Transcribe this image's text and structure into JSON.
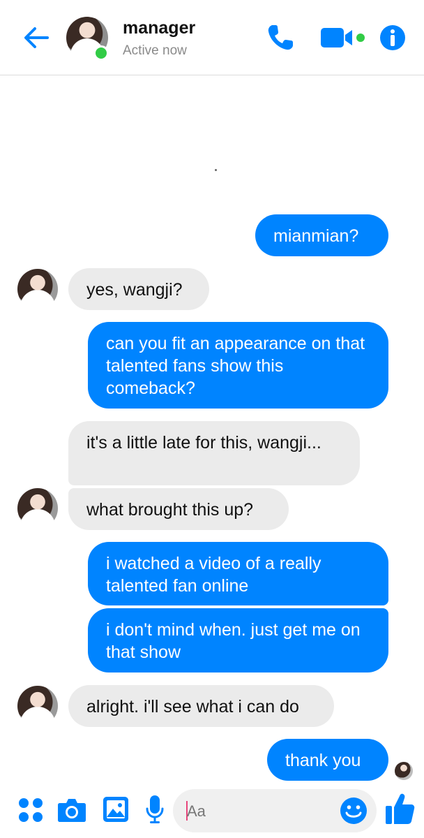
{
  "header": {
    "contact_name": "manager",
    "status": "Active now",
    "icons": [
      "back-arrow-icon",
      "phone-icon",
      "video-camera-icon",
      "info-icon"
    ]
  },
  "messages": [
    {
      "sender": "me",
      "text": "mianmian?"
    },
    {
      "sender": "manager",
      "text": "yes, wangji?"
    },
    {
      "sender": "me",
      "text": "can you fit an appearance on that talented fans show this comeback?"
    },
    {
      "sender": "manager",
      "text": "it's a little late for this, wangji..."
    },
    {
      "sender": "manager",
      "text": "what brought this up?"
    },
    {
      "sender": "me",
      "text": "i watched a video of a really talented fan online"
    },
    {
      "sender": "me",
      "text": "i don't mind when. just get me on that show"
    },
    {
      "sender": "manager",
      "text": "alright. i'll see what i can do"
    },
    {
      "sender": "me",
      "text": "thank you"
    }
  ],
  "composer": {
    "placeholder": "Aa",
    "icons": [
      "apps-grid-icon",
      "camera-icon",
      "gallery-icon",
      "microphone-icon",
      "emoji-icon",
      "thumbs-up-icon"
    ]
  },
  "colors": {
    "accent": "#0084ff",
    "incoming_bubble": "#ebebeb",
    "online": "#31cc46"
  }
}
